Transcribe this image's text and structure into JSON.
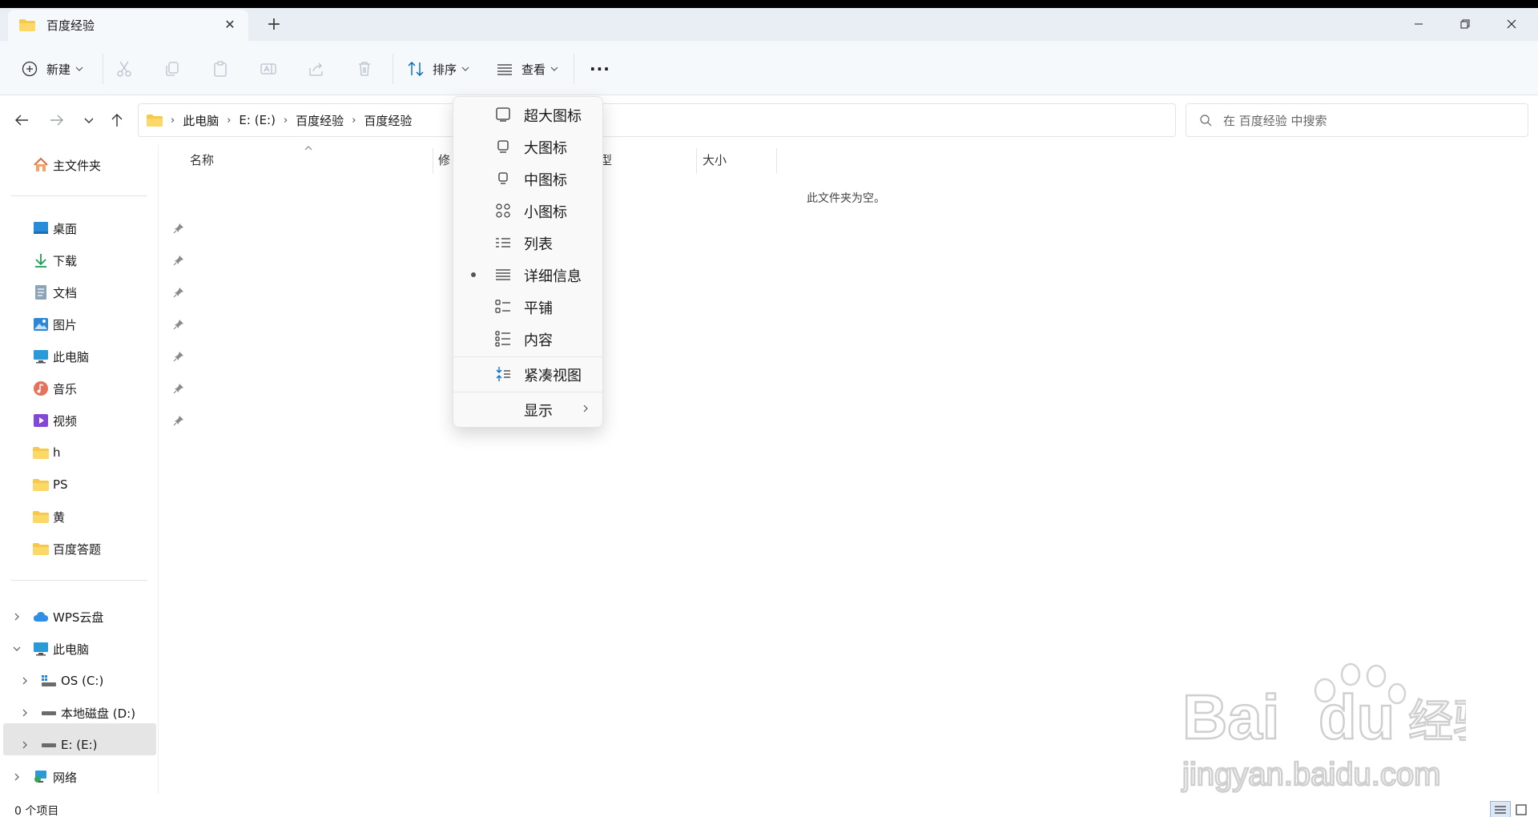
{
  "window": {
    "tab_title": "百度经验",
    "new_tab": "+"
  },
  "toolbar": {
    "new_label": "新建",
    "sort_label": "排序",
    "view_label": "查看",
    "more_label": "···"
  },
  "address": {
    "crumbs": [
      "此电脑",
      "E: (E:)",
      "百度经验",
      "百度经验"
    ],
    "search_placeholder": "在 百度经验 中搜索"
  },
  "sidebar": {
    "home": "主文件夹",
    "quick": [
      {
        "label": "桌面",
        "icon": "desktop-icon"
      },
      {
        "label": "下载",
        "icon": "download-icon"
      },
      {
        "label": "文档",
        "icon": "document-icon"
      },
      {
        "label": "图片",
        "icon": "pictures-icon"
      },
      {
        "label": "此电脑",
        "icon": "computer-icon"
      },
      {
        "label": "音乐",
        "icon": "music-icon"
      },
      {
        "label": "视频",
        "icon": "video-icon"
      },
      {
        "label": "h",
        "icon": "folder-icon"
      },
      {
        "label": "PS",
        "icon": "folder-icon"
      },
      {
        "label": "黄",
        "icon": "folder-icon"
      },
      {
        "label": "百度答题",
        "icon": "folder-icon"
      }
    ],
    "tree": [
      {
        "label": "WPS云盘",
        "icon": "cloud-icon"
      },
      {
        "label": "此电脑",
        "icon": "computer-icon"
      },
      {
        "label": "OS (C:)",
        "icon": "os-drive-icon"
      },
      {
        "label": "本地磁盘 (D:)",
        "icon": "drive-icon"
      },
      {
        "label": "E: (E:)",
        "icon": "drive-icon"
      },
      {
        "label": "网络",
        "icon": "network-icon"
      }
    ]
  },
  "columns": {
    "name": "名称",
    "modified": "修",
    "type": "型",
    "size": "大小"
  },
  "content": {
    "empty_message": "此文件夹为空。"
  },
  "status": {
    "item_count": "0 个项目"
  },
  "view_menu": {
    "items": [
      "超大图标",
      "大图标",
      "中图标",
      "小图标",
      "列表",
      "详细信息",
      "平铺",
      "内容"
    ],
    "selected": "详细信息",
    "compact": "紧凑视图",
    "show": "显示"
  },
  "colors": {
    "accent": "#0067c0",
    "folder": "#f8c84a",
    "selected_bg": "#e5e5e5",
    "menu_bg": "#f9f9f9"
  }
}
